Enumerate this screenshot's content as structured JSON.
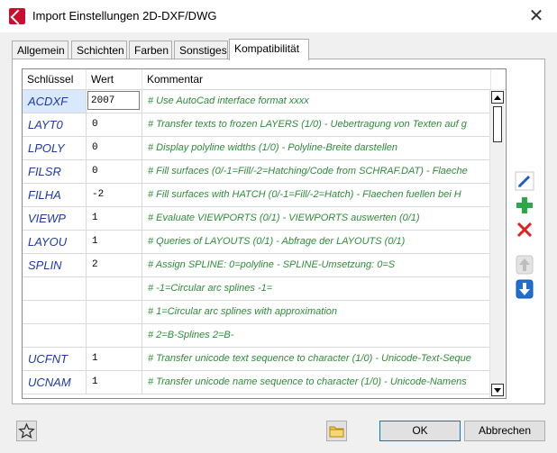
{
  "window": {
    "title": "Import Einstellungen 2D-DXF/DWG"
  },
  "tabs": [
    {
      "label": "Allgemein"
    },
    {
      "label": "Schichten"
    },
    {
      "label": "Farben"
    },
    {
      "label": "Sonstiges"
    },
    {
      "label": "Kompatibilität"
    }
  ],
  "table": {
    "headers": [
      "Schlüssel",
      "Wert",
      "Kommentar"
    ],
    "rows": [
      {
        "key": "ACDXF",
        "value": "2007",
        "comment": "# Use AutoCad interface format xxxx"
      },
      {
        "key": "LAYT0",
        "value": "0",
        "comment": "# Transfer texts to frozen LAYERS  (1/0)  -  Uebertragung von Texten auf g"
      },
      {
        "key": "LPOLY",
        "value": "0",
        "comment": "# Display polyline widths              (1/0)  -  Polyline-Breite darstellen"
      },
      {
        "key": "FILSR",
        "value": "0",
        "comment": "# Fill surfaces (0/-1=Fill/-2=Hatching/Code from SCHRAF.DAT)  -  Flaeche"
      },
      {
        "key": "FILHA",
        "value": "-2",
        "comment": "# Fill surfaces with HATCH (0/-1=Fill/-2=Hatch)  -  Flaechen fuellen bei H"
      },
      {
        "key": "VIEWP",
        "value": "1",
        "comment": "# Evaluate VIEWPORTS (0/1)  -  VIEWPORTS auswerten (0/1)"
      },
      {
        "key": "LAYOU",
        "value": "1",
        "comment": "# Queries of LAYOUTS (0/1)  -  Abfrage der LAYOUTS (0/1)"
      },
      {
        "key": "SPLIN",
        "value": "2",
        "comment": "# Assign SPLINE: 0=polyline  -                                    SPLINE-Umsetzung: 0=S"
      },
      {
        "key": "",
        "value": "",
        "comment": "#                                    -1=Circular arc splines                                         -1="
      },
      {
        "key": "",
        "value": "",
        "comment": "#                                     1=Circular arc splines with approximation"
      },
      {
        "key": "",
        "value": "",
        "comment": "#                                    2=B-Splines                                               2=B-"
      },
      {
        "key": "UCFNT",
        "value": "1",
        "comment": "# Transfer unicode text sequence to character (1/0)  -  Unicode-Text-Seque"
      },
      {
        "key": "UCNAM",
        "value": "1",
        "comment": "# Transfer unicode name sequence to character (1/0)  -  Unicode-Namens"
      }
    ]
  },
  "buttons": {
    "ok": "OK",
    "cancel": "Abbrechen"
  },
  "icons": {
    "edit": "pencil-icon",
    "add": "plus-icon",
    "delete": "red-x-icon",
    "move_up": "arrow-up-icon",
    "move_down": "arrow-down-icon",
    "favorite": "star-icon",
    "open": "folder-icon"
  },
  "colors": {
    "key_text": "#1f3aa5",
    "comment_text": "#2e8b3a",
    "accent": "#0078d7"
  }
}
